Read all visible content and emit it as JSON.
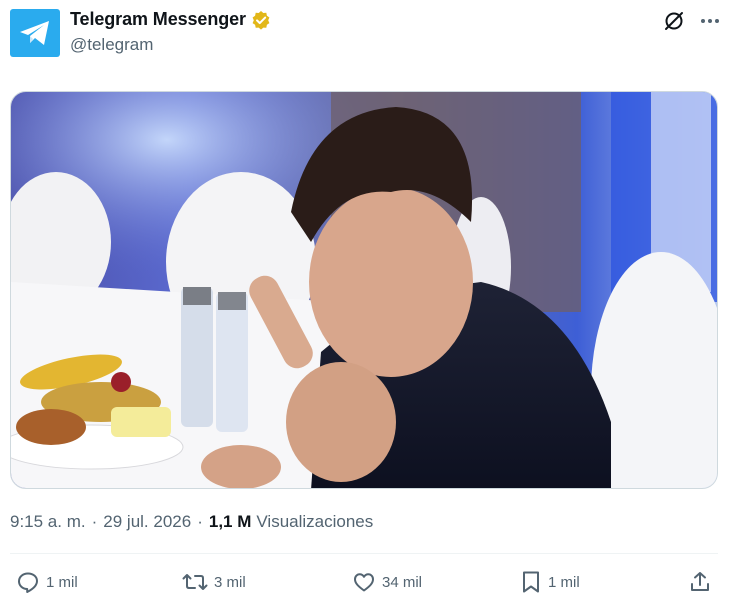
{
  "author": {
    "display_name": "Telegram Messenger",
    "handle": "@telegram",
    "verified_badge_color": "#e2b719",
    "avatar_color": "#2aabee"
  },
  "icons": {
    "avatar": "telegram-logo-icon",
    "verified": "verified-badge-icon",
    "grok": "grok-icon",
    "more": "more-icon",
    "reply": "reply-icon",
    "repost": "repost-icon",
    "like": "like-icon",
    "bookmark": "bookmark-icon",
    "share": "share-icon"
  },
  "post": {
    "time": "9:15 a. m.",
    "separator": "·",
    "date": "29 jul. 2026",
    "views_count": "1,1 M",
    "views_label": "Visualizaciones"
  },
  "actions": {
    "reply_count": "1 mil",
    "repost_count": "3 mil",
    "like_count": "34 mil",
    "bookmark_count": "1 mil"
  },
  "colors": {
    "text_primary": "#0f1419",
    "text_secondary": "#536471",
    "divider": "#eff3f4"
  }
}
